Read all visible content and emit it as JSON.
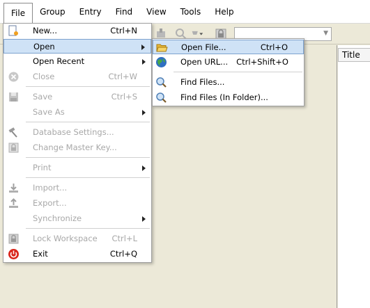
{
  "menubar": {
    "items": [
      "File",
      "Group",
      "Entry",
      "Find",
      "View",
      "Tools",
      "Help"
    ]
  },
  "columns": {
    "title": "Title"
  },
  "file_menu": {
    "new": {
      "label": "New...",
      "shortcut": "Ctrl+N"
    },
    "open": {
      "label": "Open"
    },
    "open_recent": {
      "label": "Open Recent"
    },
    "close": {
      "label": "Close",
      "shortcut": "Ctrl+W"
    },
    "save": {
      "label": "Save",
      "shortcut": "Ctrl+S"
    },
    "save_as": {
      "label": "Save As"
    },
    "database_settings": {
      "label": "Database Settings..."
    },
    "change_master_key": {
      "label": "Change Master Key..."
    },
    "print": {
      "label": "Print"
    },
    "import": {
      "label": "Import..."
    },
    "export": {
      "label": "Export..."
    },
    "synchronize": {
      "label": "Synchronize"
    },
    "lock_workspace": {
      "label": "Lock Workspace",
      "shortcut": "Ctrl+L"
    },
    "exit": {
      "label": "Exit",
      "shortcut": "Ctrl+Q"
    }
  },
  "open_menu": {
    "open_file": {
      "label": "Open File...",
      "shortcut": "Ctrl+O"
    },
    "open_url": {
      "label": "Open URL...",
      "shortcut": "Ctrl+Shift+O"
    },
    "find_files": {
      "label": "Find Files..."
    },
    "find_files_in_folder": {
      "label": "Find Files (In Folder)..."
    }
  },
  "colors": {
    "highlight": "#cfe2f6",
    "highlight_border": "#7da2ce",
    "disabled_text": "#a8a8a8",
    "window_bg": "#ece9d8"
  },
  "icons": {
    "new": "new-database-icon",
    "open_file": "folder-open-icon",
    "open_url": "globe-icon",
    "find_files": "magnifier-icon",
    "close": "close-circle-icon",
    "save": "floppy-disk-icon",
    "database_settings": "hammer-icon",
    "change_master_key": "key-icon",
    "import": "import-arrow-icon",
    "export": "export-arrow-icon",
    "lock_workspace": "lock-icon",
    "exit": "power-icon"
  }
}
